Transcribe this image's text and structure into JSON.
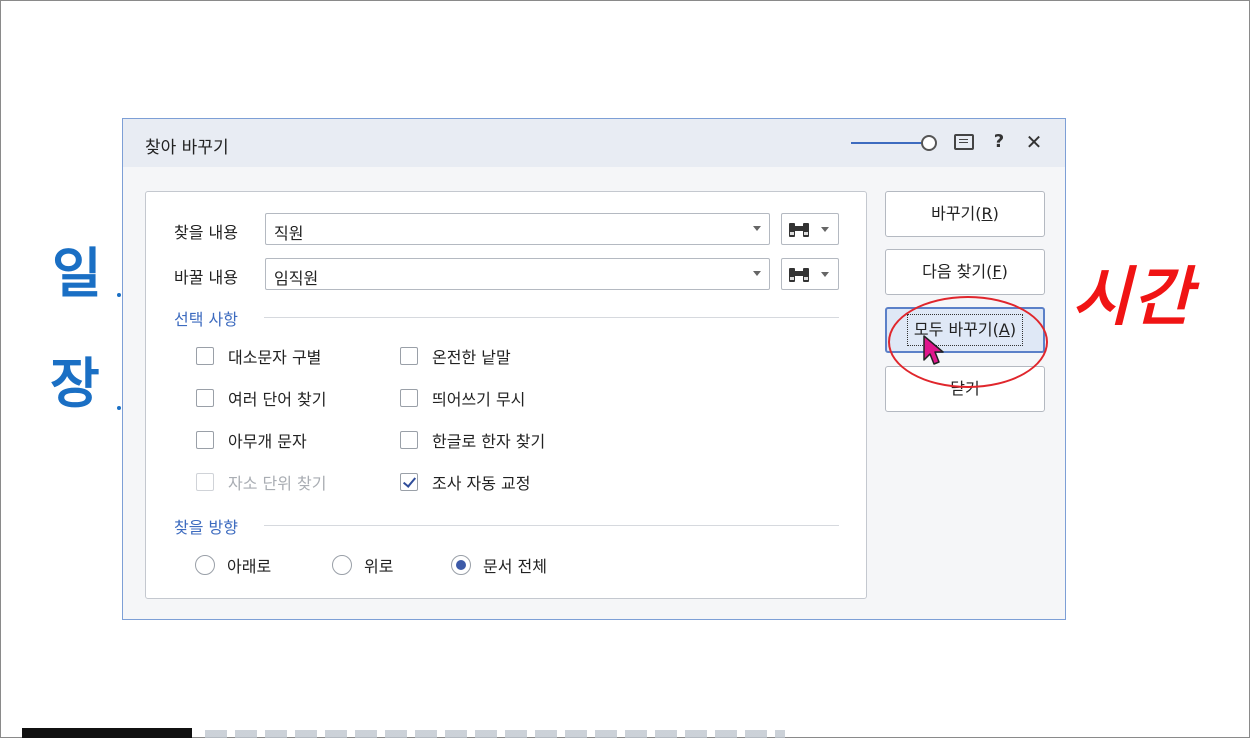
{
  "background": {
    "chars": [
      "일",
      "장"
    ]
  },
  "dialog": {
    "title": "찾아 바꾸기",
    "icons": [
      "memo-icon",
      "help-icon",
      "close-icon"
    ],
    "help_label": "?",
    "close_label": "✕",
    "find": {
      "label": "찾을 내용",
      "value": "직원"
    },
    "replace": {
      "label": "바꿀 내용",
      "value": "임직원"
    },
    "options": {
      "title": "선택 사항",
      "items": [
        {
          "label": "대소문자 구별",
          "checked": false,
          "enabled": true
        },
        {
          "label": "온전한 낱말",
          "checked": false,
          "enabled": true
        },
        {
          "label": "여러 단어 찾기",
          "checked": false,
          "enabled": true
        },
        {
          "label": "띄어쓰기 무시",
          "checked": false,
          "enabled": true
        },
        {
          "label": "아무개 문자",
          "checked": false,
          "enabled": true
        },
        {
          "label": "한글로 한자 찾기",
          "checked": false,
          "enabled": true
        },
        {
          "label": "자소 단위 찾기",
          "checked": false,
          "enabled": false
        },
        {
          "label": "조사 자동 교정",
          "checked": true,
          "enabled": true
        }
      ]
    },
    "direction": {
      "title": "찾을 방향",
      "items": [
        {
          "label": "아래로",
          "selected": false
        },
        {
          "label": "위로",
          "selected": false
        },
        {
          "label": "문서 전체",
          "selected": true
        }
      ]
    },
    "buttons": {
      "replace": {
        "text": "바꾸기(",
        "key": "R",
        "end": ")"
      },
      "find_next": {
        "text": "다음 찾기(",
        "key": "F",
        "end": ")"
      },
      "replace_all": {
        "text": "모두 바꾸기(",
        "key": "A",
        "end": ")"
      },
      "close": {
        "text": "닫기"
      }
    }
  },
  "annotation": {
    "text": "시간",
    "color": "#f01414"
  },
  "colors": {
    "accent": "#3d6bbf",
    "background_text": "#1a6fc4",
    "cursor": "#e0168c"
  }
}
